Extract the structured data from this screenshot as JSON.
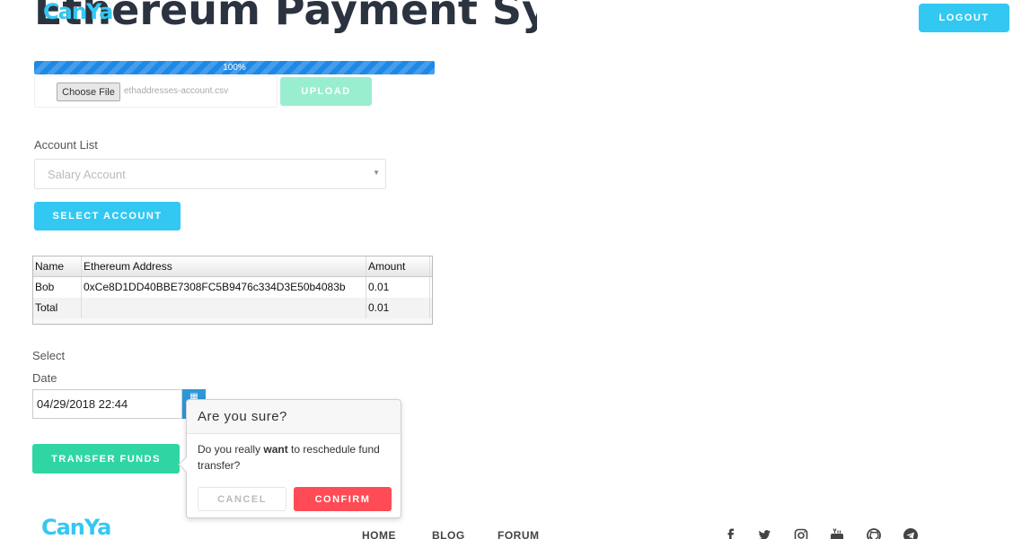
{
  "header": {
    "logo": "CanYa",
    "page_title": "Ethereum Payment System",
    "logout_label": "LOGOUT"
  },
  "upload": {
    "progress_label": "100%",
    "progress_value": 100,
    "choose_file_label": "Choose File",
    "file_name": "ethaddresses-account.csv",
    "upload_label": "UPLOAD"
  },
  "account": {
    "label": "Account List",
    "selected": "Salary Account",
    "select_button": "SELECT ACCOUNT"
  },
  "table": {
    "columns": [
      "Name",
      "Ethereum Address",
      "Amount"
    ],
    "rows": [
      [
        "Bob",
        "0xCe8D1DD40BBE7308FC5B9476c334D3E50b4083b",
        "0.01"
      ]
    ],
    "total": [
      "Total",
      "",
      "0.01"
    ]
  },
  "date": {
    "select_label": "Select",
    "date_label": "Date",
    "value": "04/29/2018 22:44"
  },
  "transfer_label": "TRANSFER FUNDS",
  "popover": {
    "title": "Are you sure?",
    "body_pre": "Do you really ",
    "body_bold": "want",
    "body_post": " to reschedule fund transfer?",
    "cancel_label": "CANCEL",
    "confirm_label": "CONFIRM"
  },
  "footer": {
    "logo": "CanYa",
    "nav": [
      "HOME",
      "BLOG",
      "FORUM"
    ],
    "social_icons": [
      "facebook-icon",
      "twitter-icon",
      "instagram-icon",
      "youtube-icon",
      "github-icon",
      "telegram-icon"
    ]
  },
  "colors": {
    "brand": "#33c8f2",
    "progress": "#1e88e5",
    "upload_disabled": "#9aeed0",
    "transfer": "#2fd6a4",
    "confirm": "#ff4b55",
    "calendar": "#2e97d8"
  }
}
